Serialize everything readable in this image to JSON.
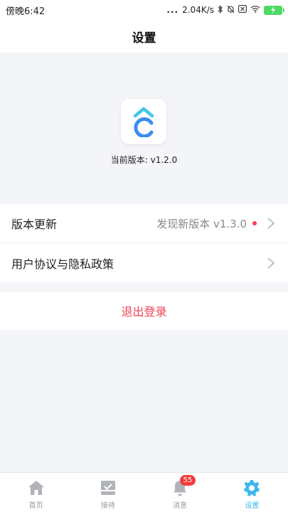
{
  "status_bar": {
    "time": "傍晚6:42",
    "dots": "...",
    "network_speed": "2.04K/s",
    "battery_icon": "battery-charging-icon"
  },
  "nav": {
    "title": "设置"
  },
  "version": {
    "current_label": "当前版本: v1.2.0"
  },
  "settings": {
    "update_label": "版本更新",
    "update_value": "发现新版本 v1.3.0",
    "agreement_label": "用户协议与隐私政策"
  },
  "logout": {
    "label": "退出登录"
  },
  "tabs": [
    {
      "label": "首页",
      "icon": "home-icon"
    },
    {
      "label": "接待",
      "icon": "reception-icon"
    },
    {
      "label": "消息",
      "icon": "bell-icon",
      "badge": "55"
    },
    {
      "label": "设置",
      "icon": "gear-icon",
      "active": true
    }
  ],
  "colors": {
    "accent": "#3cb8e8",
    "danger": "#f0414f",
    "badge": "#f53b3b",
    "inactive_icon": "#b0b3b8"
  }
}
